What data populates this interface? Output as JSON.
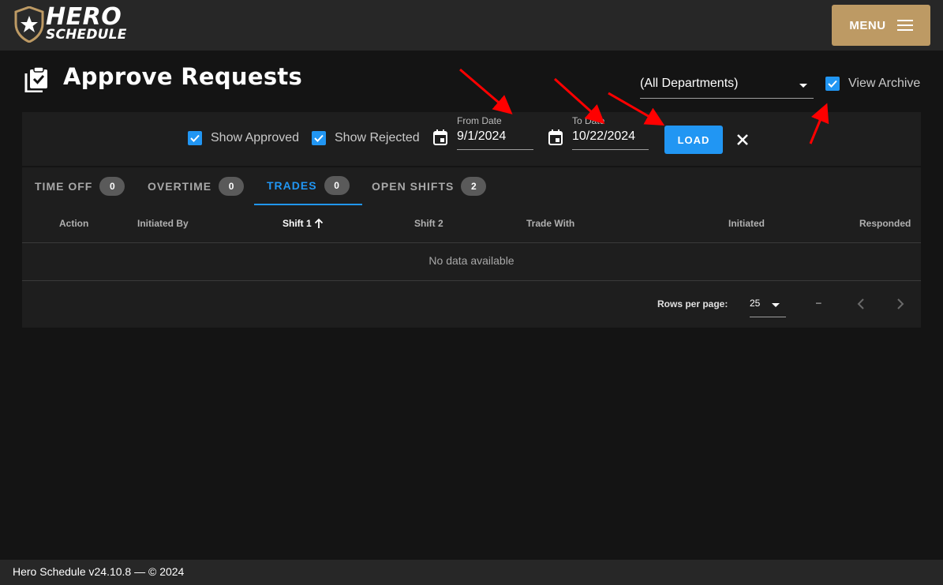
{
  "header": {
    "logo_line1": "HERO",
    "logo_line2": "SCHEDULE",
    "menu_label": "MENU",
    "brand_color": "#bd9a64"
  },
  "page": {
    "title": "Approve Requests",
    "title_icon": "clipboard-check-icon"
  },
  "filters": {
    "department": "(All Departments)",
    "view_archive_label": "View Archive",
    "view_archive_checked": true,
    "show_approved_label": "Show Approved",
    "show_approved_checked": true,
    "show_rejected_label": "Show Rejected",
    "show_rejected_checked": true,
    "from_date_label": "From Date",
    "from_date_value": "9/1/2024",
    "to_date_label": "To Date",
    "to_date_value": "10/22/2024",
    "load_label": "LOAD",
    "accent_color": "#2196f3"
  },
  "tabs": [
    {
      "label": "TIME OFF",
      "count": "0",
      "active": false
    },
    {
      "label": "OVERTIME",
      "count": "0",
      "active": false
    },
    {
      "label": "TRADES",
      "count": "0",
      "active": true
    },
    {
      "label": "OPEN SHIFTS",
      "count": "2",
      "active": false
    }
  ],
  "table": {
    "columns": [
      "Action",
      "Initiated By",
      "Shift 1",
      "Shift 2",
      "Trade With",
      "Initiated",
      "Responded"
    ],
    "sorted_column": "Shift 1",
    "empty_text": "No data available",
    "rows_per_page_label": "Rows per page:",
    "rows_per_page_value": "25",
    "page_info": "–"
  },
  "footer": {
    "text": "Hero Schedule v24.10.8 — © 2024"
  }
}
